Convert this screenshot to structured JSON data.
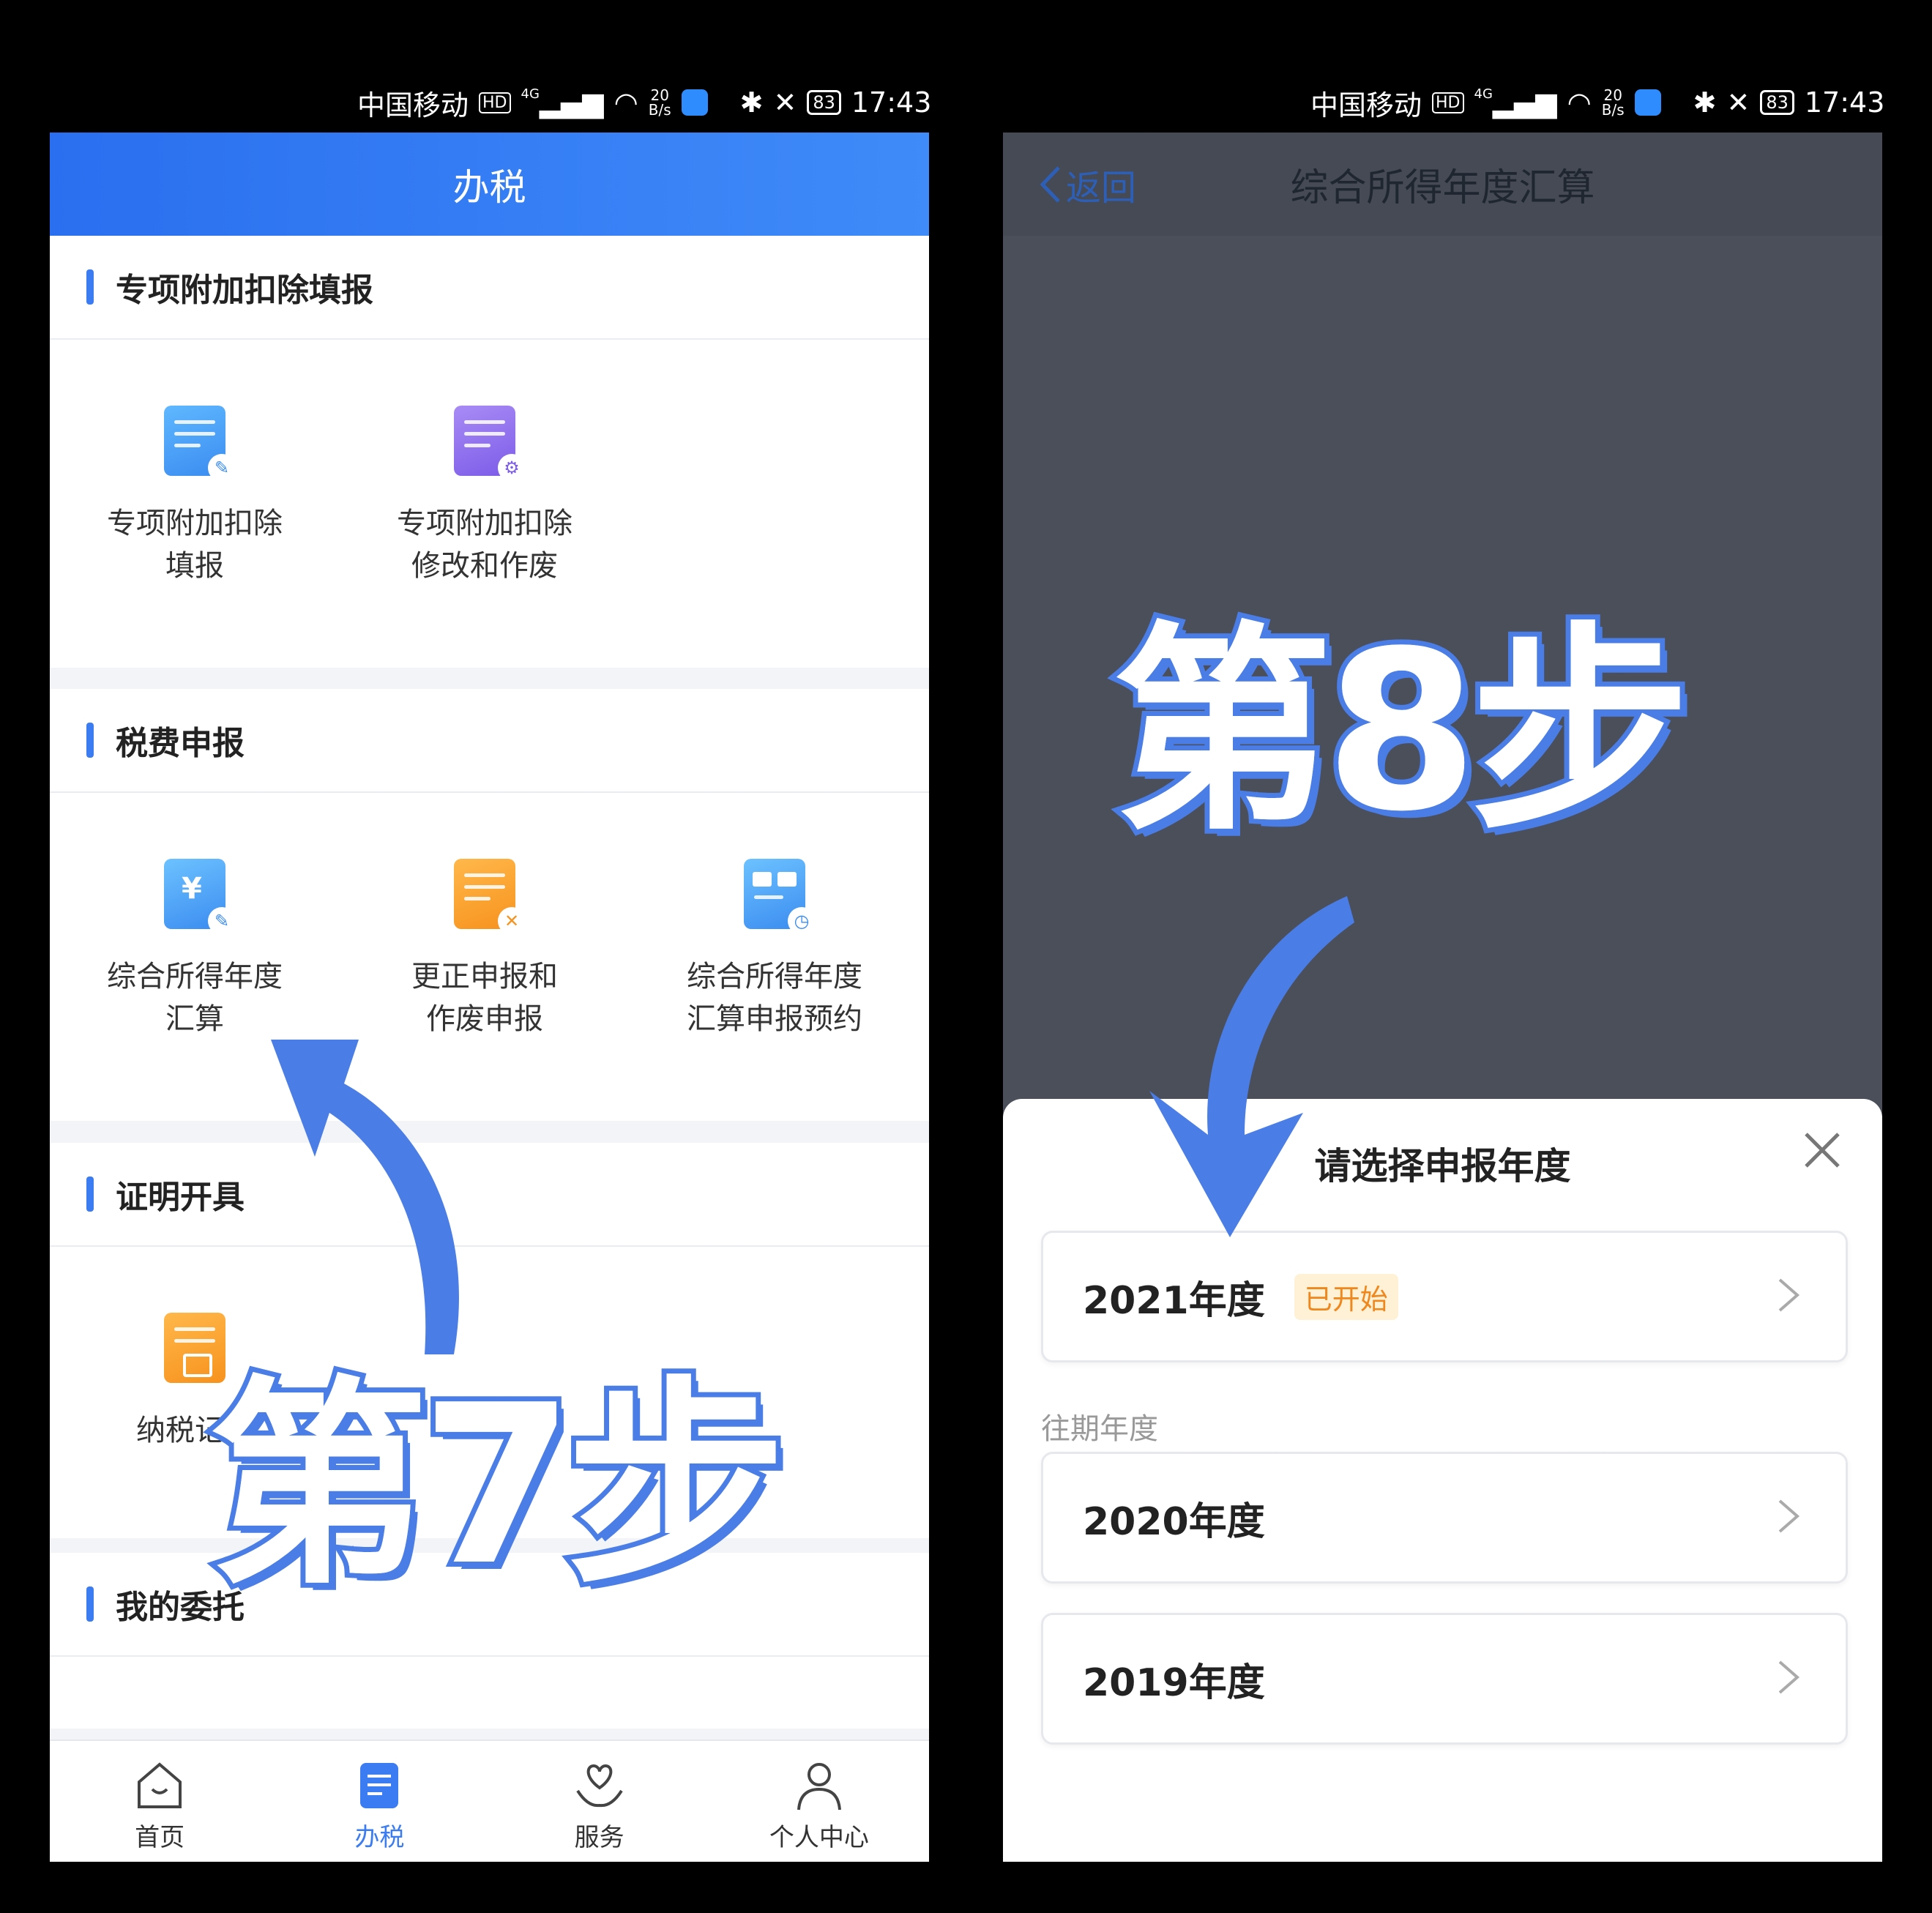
{
  "left_status": {
    "carrier": "中国移动",
    "hd": "HD",
    "signal": "4G",
    "net_top": "20",
    "net_bottom": "B/s",
    "battery": "83",
    "time": "17:43"
  },
  "right_status": {
    "carrier": "中国移动",
    "hd": "HD",
    "signal": "4G",
    "net_top": "20",
    "net_bottom": "B/s",
    "battery": "83",
    "time": "17:43"
  },
  "left": {
    "header_title": "办税",
    "sections": [
      {
        "title": "专项附加扣除填报",
        "tiles": [
          {
            "line1": "专项附加扣除",
            "line2": "填报"
          },
          {
            "line1": "专项附加扣除",
            "line2": "修改和作废"
          }
        ]
      },
      {
        "title": "税费申报",
        "tiles": [
          {
            "line1": "综合所得年度",
            "line2": "汇算"
          },
          {
            "line1": "更正申报和",
            "line2": "作废申报"
          },
          {
            "line1": "综合所得年度",
            "line2": "汇算申报预约"
          }
        ]
      },
      {
        "title": "证明开具",
        "tiles": [
          {
            "line1": "纳税记录",
            "line2": ""
          }
        ]
      },
      {
        "title": "我的委托"
      }
    ],
    "tabs": [
      {
        "label": "首页"
      },
      {
        "label": "办税"
      },
      {
        "label": "服务"
      },
      {
        "label": "个人中心"
      }
    ],
    "overlay_text": "第7步"
  },
  "right": {
    "back_label": "返回",
    "header_title": "综合所得年度汇算",
    "sheet_title": "请选择申报年度",
    "current_year": {
      "label": "2021年度",
      "tag": "已开始"
    },
    "past_label": "往期年度",
    "past_years": [
      {
        "label": "2020年度"
      },
      {
        "label": "2019年度"
      }
    ],
    "overlay_text": "第8步"
  },
  "colors": {
    "brand_blue": "#3b7cf3",
    "overlay_blue": "#4a7de6",
    "tag_orange": "#f0871c"
  }
}
